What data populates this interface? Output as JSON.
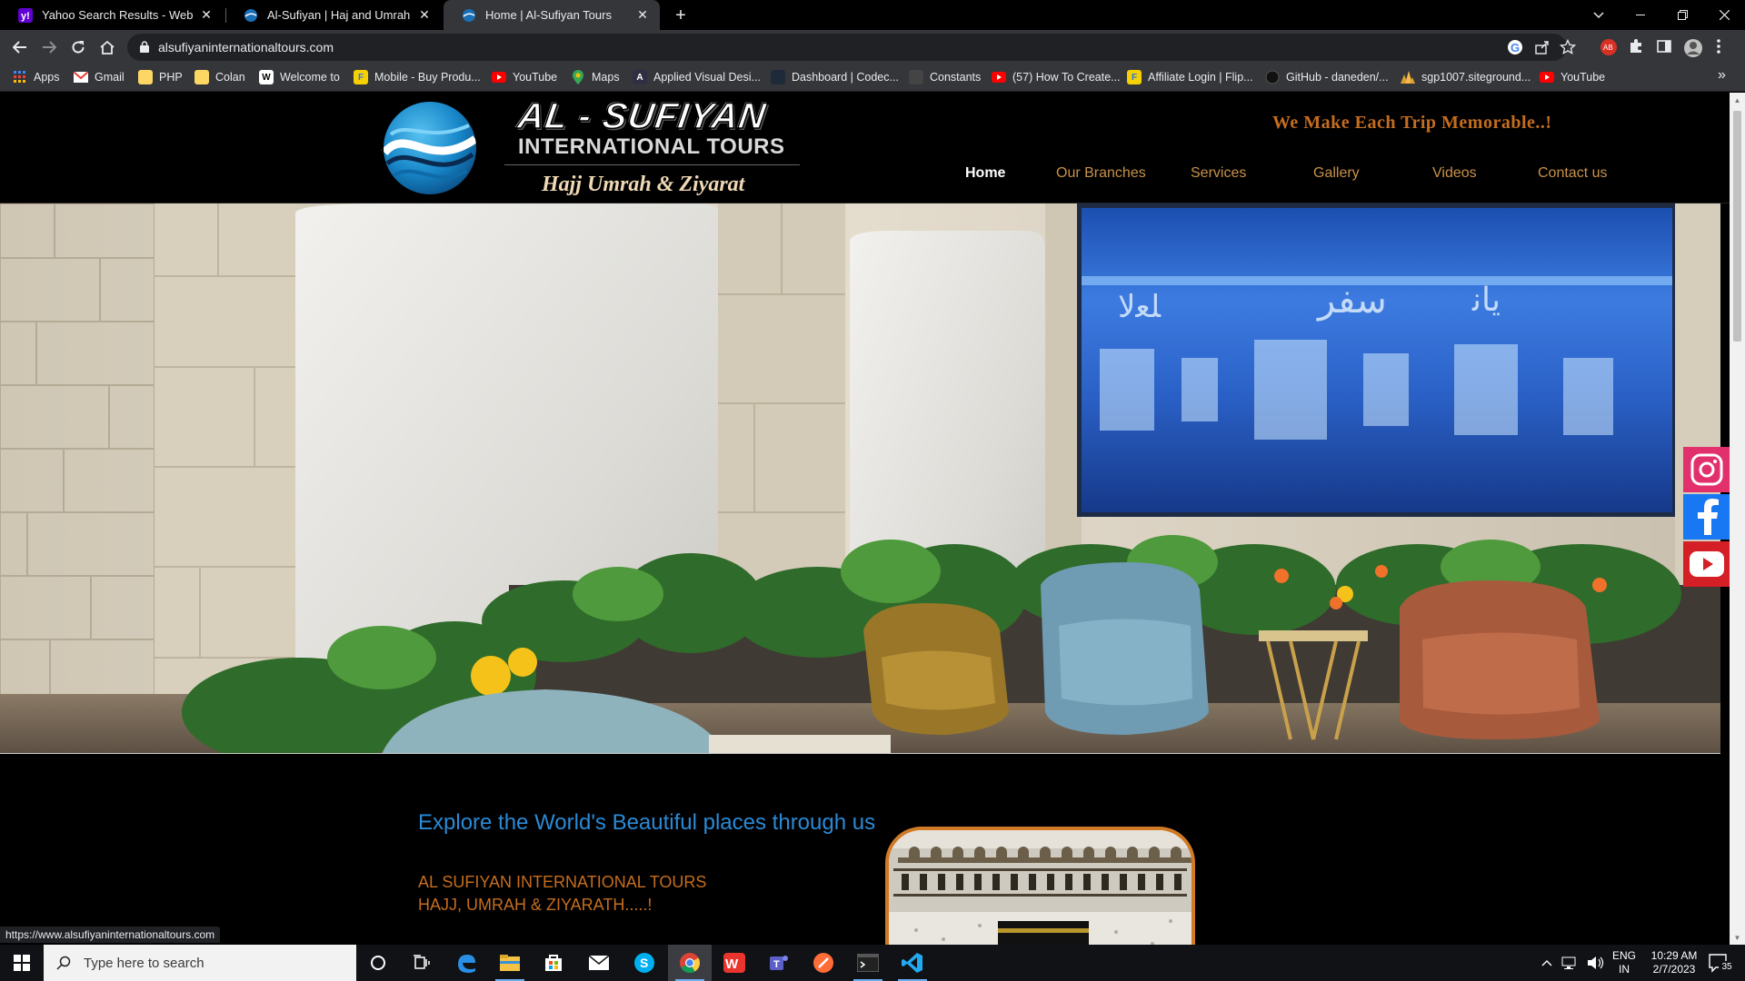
{
  "browser": {
    "tabs": [
      {
        "title": "Yahoo Search Results - Web search",
        "favicon": "yahoo-icon"
      },
      {
        "title": "Al-Sufiyan | Haj and Umrah Services",
        "favicon": "globe-icon"
      },
      {
        "title": "Home | Al-Sufiyan Tours",
        "favicon": "globe-icon",
        "active": true
      }
    ],
    "url": "alsufiyaninternationaltours.com",
    "bookmarks": [
      {
        "label": "Apps",
        "icon": "apps-grid-icon"
      },
      {
        "label": "Gmail",
        "icon": "gmail-icon"
      },
      {
        "label": "PHP",
        "icon": "folder-icon"
      },
      {
        "label": "Colan",
        "icon": "folder-icon"
      },
      {
        "label": "Welcome to",
        "icon": "site-icon"
      },
      {
        "label": "Mobile - Buy Produ...",
        "icon": "flipkart-icon"
      },
      {
        "label": "YouTube",
        "icon": "youtube-icon"
      },
      {
        "label": "Maps",
        "icon": "maps-icon"
      },
      {
        "label": "Applied Visual Desi...",
        "icon": "site-icon"
      },
      {
        "label": "Dashboard | Codec...",
        "icon": "site-icon"
      },
      {
        "label": "Constants",
        "icon": "site-icon"
      },
      {
        "label": "(57) How To Create...",
        "icon": "youtube-icon"
      },
      {
        "label": "Affiliate Login | Flip...",
        "icon": "flipkart-icon"
      },
      {
        "label": "GitHub - daneden/...",
        "icon": "github-icon"
      },
      {
        "label": "sgp1007.siteground...",
        "icon": "siteground-icon"
      },
      {
        "label": "YouTube",
        "icon": "youtube-icon"
      }
    ],
    "overflow_label": "»",
    "status_url": "https://www.alsufiyaninternationaltours.com"
  },
  "site": {
    "logo": {
      "title": "AL - SUFIYAN",
      "subtitle": "INTERNATIONAL TOURS",
      "tagline": "Hajj Umrah & Ziyarat"
    },
    "slogan": "We Make Each Trip Memorable..!",
    "nav": [
      "Home",
      "Our Branches",
      "Services",
      "Gallery",
      "Videos",
      "Contact us"
    ],
    "active_nav": "Home",
    "social": [
      "instagram-icon",
      "facebook-icon",
      "youtube-icon"
    ],
    "intro": {
      "heading": "Explore the World's Beautiful places through us",
      "line1": "AL SUFIYAN INTERNATIONAL TOURS",
      "line2": "HAJJ, UMRAH & ZIYARATH.....!"
    }
  },
  "taskbar": {
    "search_placeholder": "Type here to search",
    "lang_line1": "ENG",
    "lang_line2": "IN",
    "time": "10:29 AM",
    "date": "2/7/2023",
    "notification_count": "35"
  },
  "colors": {
    "accent_orange": "#c46d1f",
    "nav_gold": "#c8914a",
    "heading_blue": "#2b8ad6"
  }
}
